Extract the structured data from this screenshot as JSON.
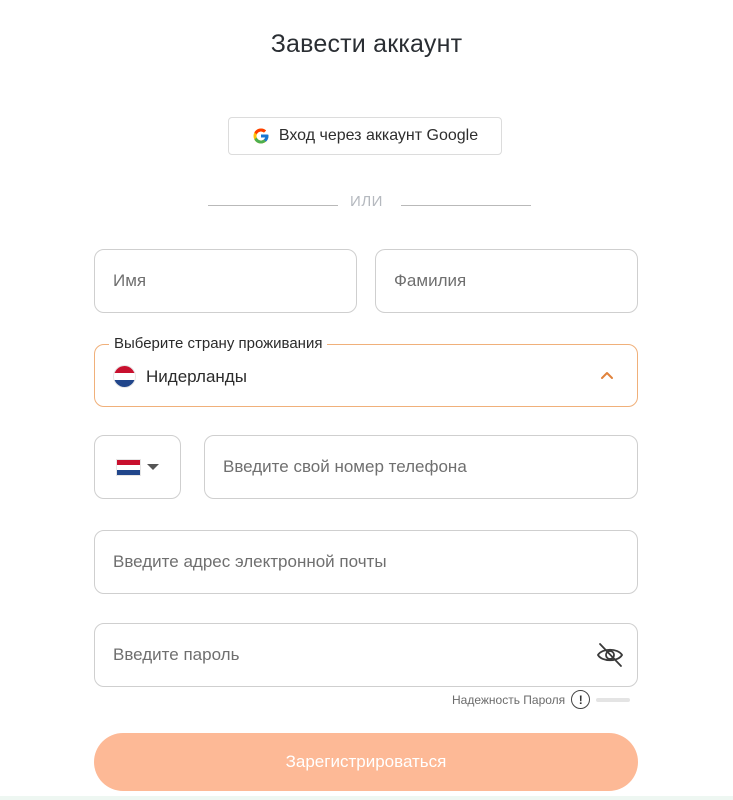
{
  "title": "Завести аккаунт",
  "google_button": {
    "label": "Вход через аккаунт Google",
    "icon": "google-icon"
  },
  "divider_text": "ИЛИ",
  "fields": {
    "first_name_placeholder": "Имя",
    "last_name_placeholder": "Фамилия",
    "country_label": "Выберите страну проживания",
    "country_value": "Нидерланды",
    "phone_placeholder": "Введите свой номер телефона",
    "email_placeholder": "Введите адрес электронной почты",
    "password_placeholder": "Введите пароль"
  },
  "password_strength": {
    "label": "Надежность Пароля",
    "icon": "alert-icon",
    "value": 0
  },
  "submit_label": "Зарегистрироваться",
  "colors": {
    "accent": "#f0b07a",
    "button": "#fdb996"
  }
}
